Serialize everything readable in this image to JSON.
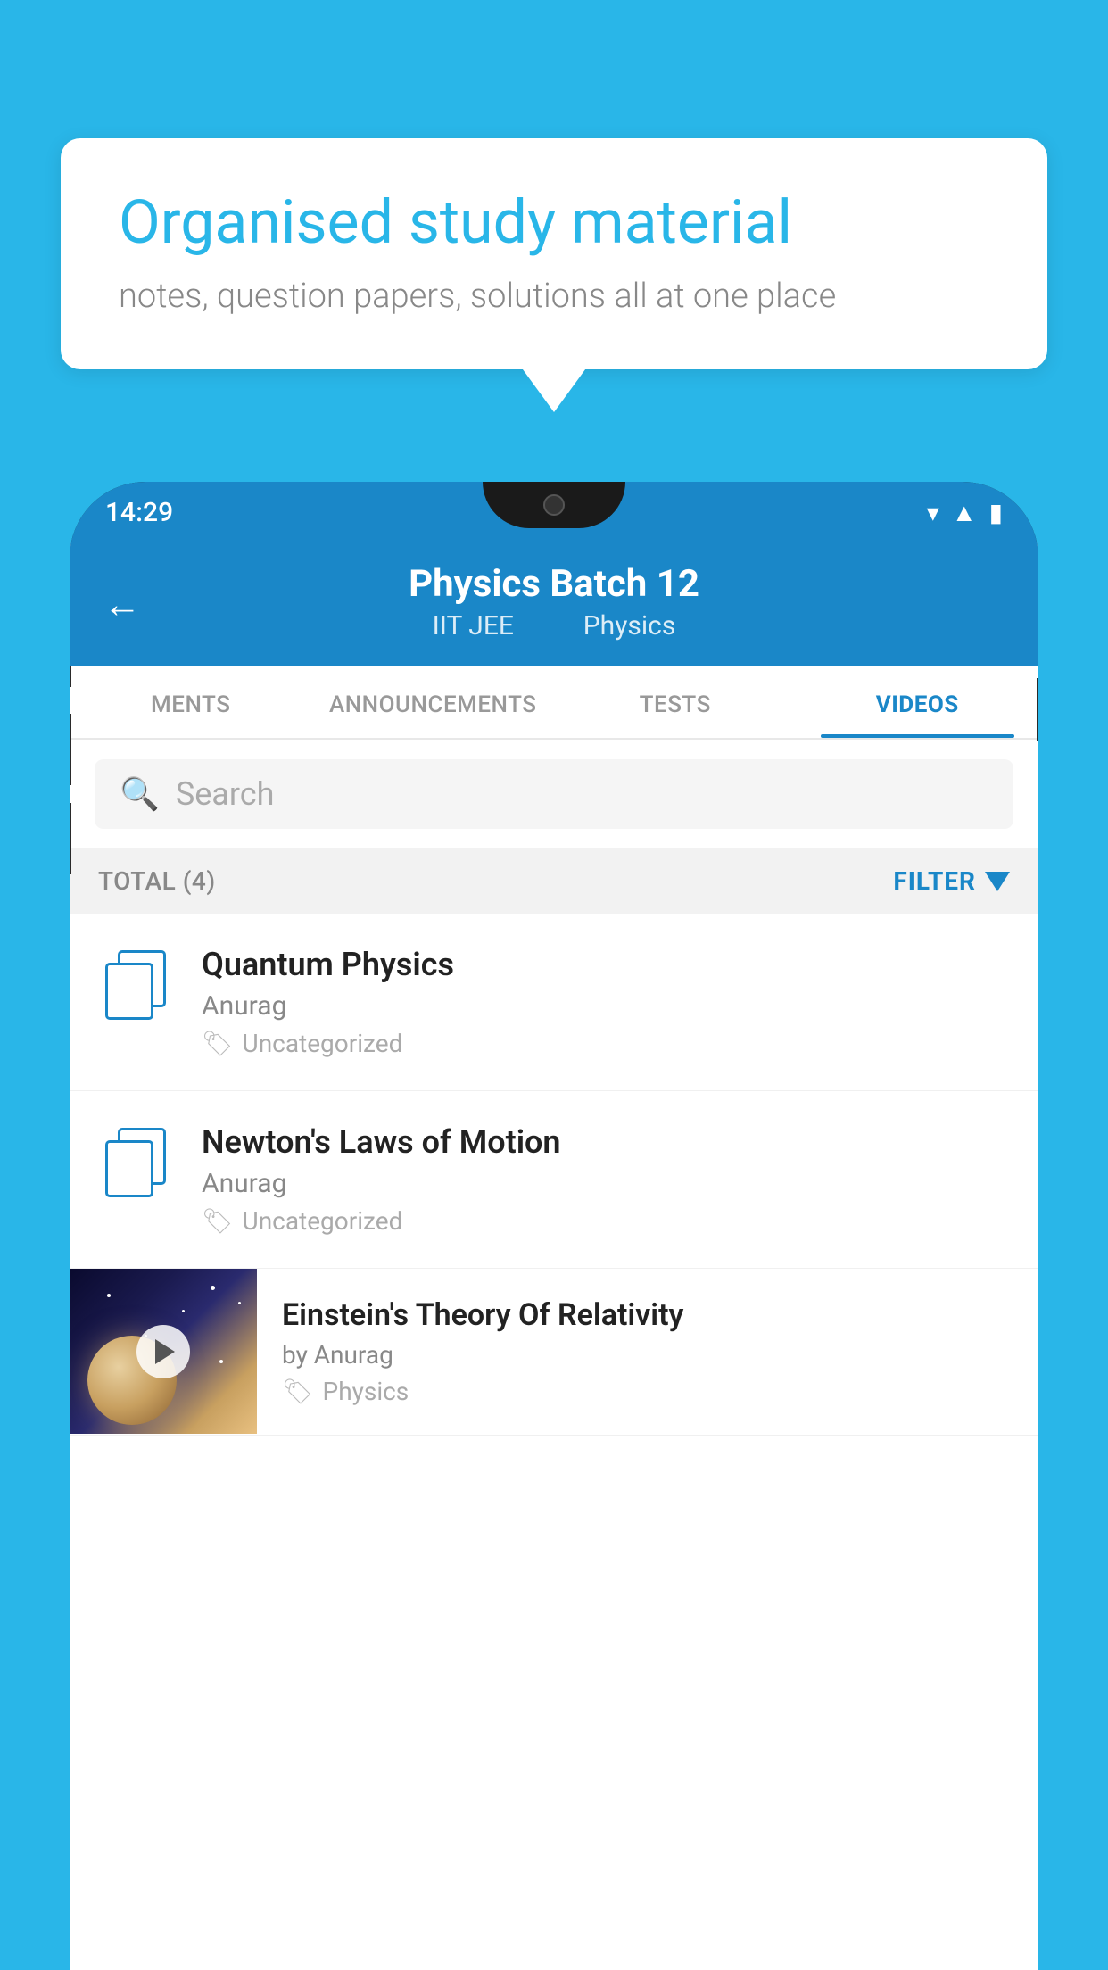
{
  "background": {
    "color": "#29b6e8"
  },
  "speech_bubble": {
    "heading": "Organised study material",
    "subtext": "notes, question papers, solutions all at one place"
  },
  "status_bar": {
    "time": "14:29"
  },
  "app_header": {
    "title": "Physics Batch 12",
    "subtitle_part1": "IIT JEE",
    "subtitle_part2": "Physics",
    "back_label": "←"
  },
  "tabs": [
    {
      "label": "MENTS",
      "active": false
    },
    {
      "label": "ANNOUNCEMENTS",
      "active": false
    },
    {
      "label": "TESTS",
      "active": false
    },
    {
      "label": "VIDEOS",
      "active": true
    }
  ],
  "search": {
    "placeholder": "Search"
  },
  "filter_bar": {
    "total_label": "TOTAL (4)",
    "filter_label": "FILTER"
  },
  "video_list": [
    {
      "id": 1,
      "title": "Quantum Physics",
      "author": "Anurag",
      "tag": "Uncategorized",
      "has_thumbnail": false
    },
    {
      "id": 2,
      "title": "Newton's Laws of Motion",
      "author": "Anurag",
      "tag": "Uncategorized",
      "has_thumbnail": false
    },
    {
      "id": 3,
      "title": "Einstein's Theory Of Relativity",
      "author": "by Anurag",
      "tag": "Physics",
      "has_thumbnail": true
    }
  ]
}
